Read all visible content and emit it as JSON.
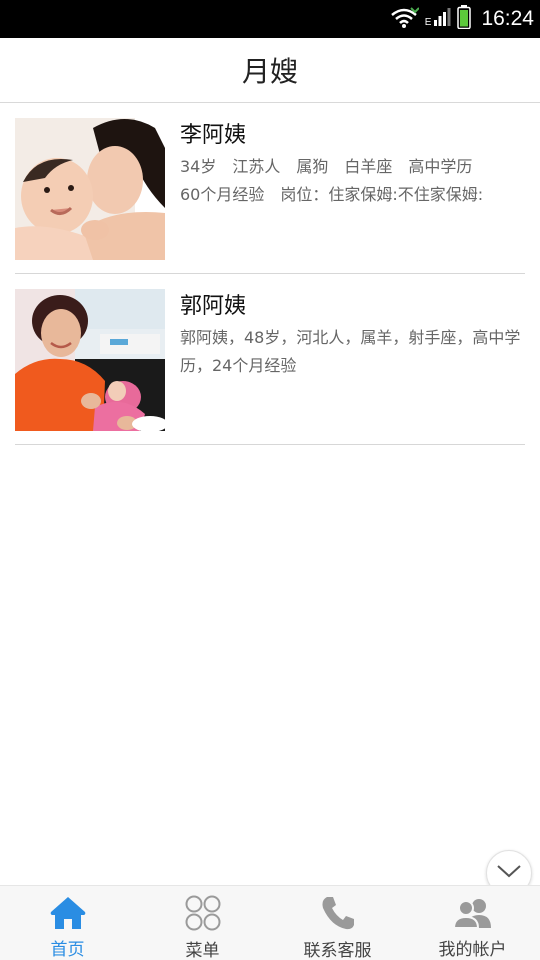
{
  "status_bar": {
    "network": "E",
    "time": "16:24"
  },
  "header": {
    "title": "月嫂"
  },
  "nannies": [
    {
      "name": "李阿姨",
      "description": "34岁　江苏人　属狗　白羊座　高中学历\n60个月经验　岗位：住家保姆:不住家保姆:"
    },
    {
      "name": "郭阿姨",
      "description": "郭阿姨，48岁，河北人，属羊，射手座，高中学历，24个月经验"
    }
  ],
  "tabs": [
    {
      "label": "首页",
      "icon": "home-icon",
      "active": true
    },
    {
      "label": "菜单",
      "icon": "grid-icon",
      "active": false
    },
    {
      "label": "联系客服",
      "icon": "phone-icon",
      "active": false
    },
    {
      "label": "我的帐户",
      "icon": "users-icon",
      "active": false
    }
  ],
  "colors": {
    "accent": "#2a8de3",
    "inactive_icon": "#9a9a9a"
  }
}
